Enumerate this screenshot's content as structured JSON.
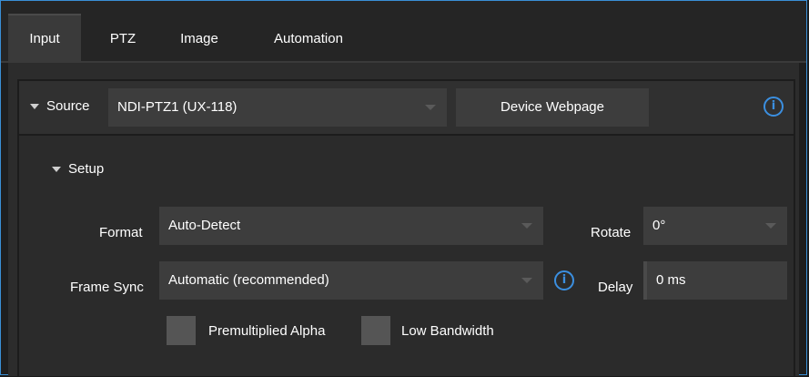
{
  "tabs": [
    {
      "label": "Input",
      "active": true
    },
    {
      "label": "PTZ",
      "active": false
    },
    {
      "label": "Image",
      "active": false
    },
    {
      "label": "Automation",
      "active": false
    }
  ],
  "source": {
    "label": "Source",
    "selected": "NDI-PTZ1 (UX-118)",
    "webpage_button": "Device Webpage"
  },
  "setup": {
    "label": "Setup",
    "format_label": "Format",
    "format_value": "Auto-Detect",
    "rotate_label": "Rotate",
    "rotate_value": "0°",
    "frame_sync_label": "Frame Sync",
    "frame_sync_value": "Automatic (recommended)",
    "delay_label": "Delay",
    "delay_value": "0 ms",
    "premultiplied_label": "Premultiplied Alpha",
    "low_bandwidth_label": "Low Bandwidth"
  },
  "info_glyph": "i",
  "colors": {
    "accent": "#3b8fe0",
    "background": "#1e1e1e",
    "panel": "#2c2c2c",
    "control": "#3d3d3d"
  }
}
